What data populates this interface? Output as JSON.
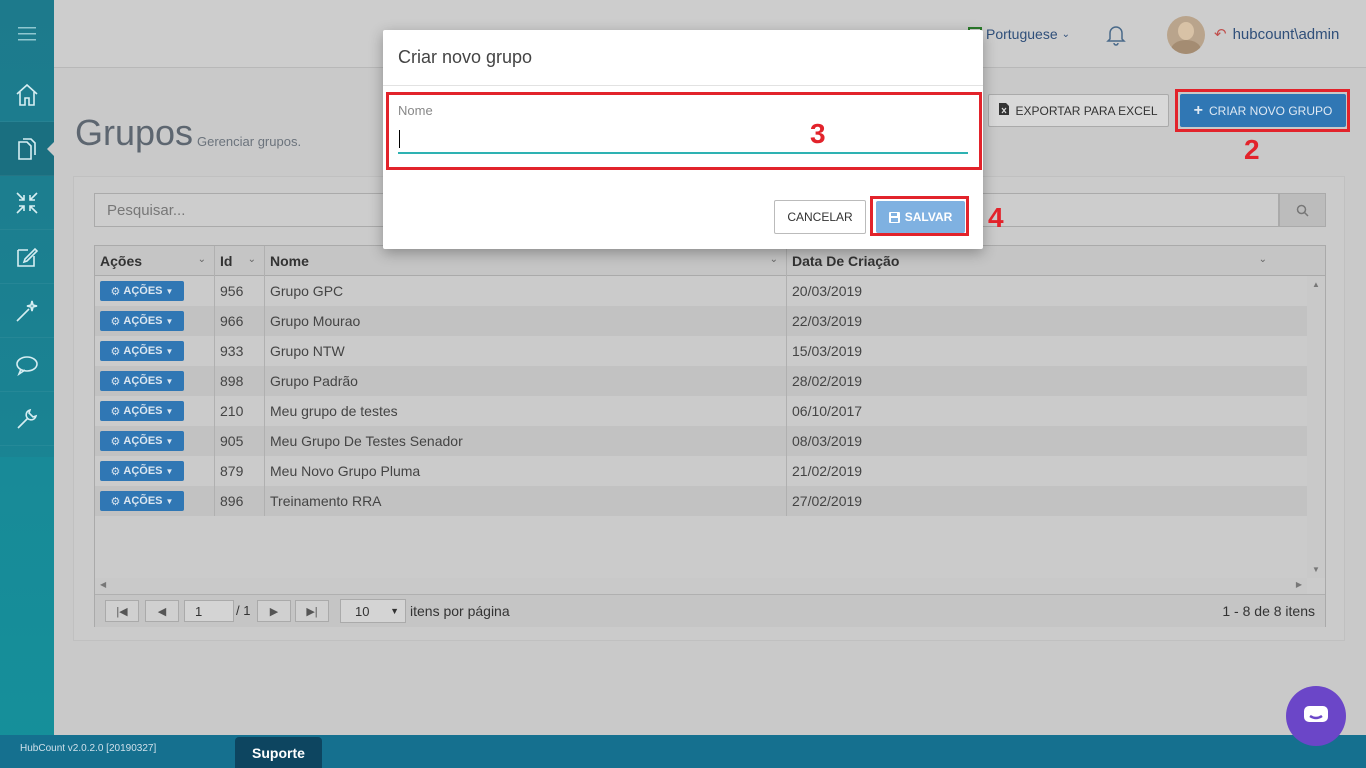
{
  "header": {
    "language": "Portuguese",
    "user": "hubcount\\admin"
  },
  "page": {
    "title": "Grupos",
    "subtitle": "Gerenciar grupos.",
    "export_label": "EXPORTAR PARA EXCEL",
    "create_label": "CRIAR NOVO GRUPO"
  },
  "search": {
    "placeholder": "Pesquisar..."
  },
  "grid": {
    "columns": [
      "Ações",
      "Id",
      "Nome",
      "Data De Criação"
    ],
    "action_label": "AÇÕES",
    "rows": [
      {
        "id": "956",
        "nome": "Grupo GPC",
        "data": "20/03/2019"
      },
      {
        "id": "966",
        "nome": "Grupo Mourao",
        "data": "22/03/2019"
      },
      {
        "id": "933",
        "nome": "Grupo NTW",
        "data": "15/03/2019"
      },
      {
        "id": "898",
        "nome": "Grupo Padrão",
        "data": "28/02/2019"
      },
      {
        "id": "210",
        "nome": "Meu grupo de testes",
        "data": "06/10/2017"
      },
      {
        "id": "905",
        "nome": "Meu Grupo De Testes Senador",
        "data": "08/03/2019"
      },
      {
        "id": "879",
        "nome": "Meu Novo Grupo Pluma",
        "data": "21/02/2019"
      },
      {
        "id": "896",
        "nome": "Treinamento RRA",
        "data": "27/02/2019"
      }
    ]
  },
  "pager": {
    "page": "1",
    "of": "/ 1",
    "page_size": "10",
    "per_page_label": "itens por página",
    "summary": "1 - 8 de 8 itens"
  },
  "modal": {
    "title": "Criar novo grupo",
    "field_label": "Nome",
    "cancel_label": "CANCELAR",
    "save_label": "SALVAR"
  },
  "annotations": [
    "2",
    "3",
    "4"
  ],
  "footer": {
    "version": "HubCount v2.0.2.0 [20190327]",
    "support": "Suporte"
  },
  "colors": {
    "accent": "#3077b4",
    "highlight": "#e2232b",
    "sidebar": "#1d7a8c",
    "chat": "#6b46c8"
  }
}
